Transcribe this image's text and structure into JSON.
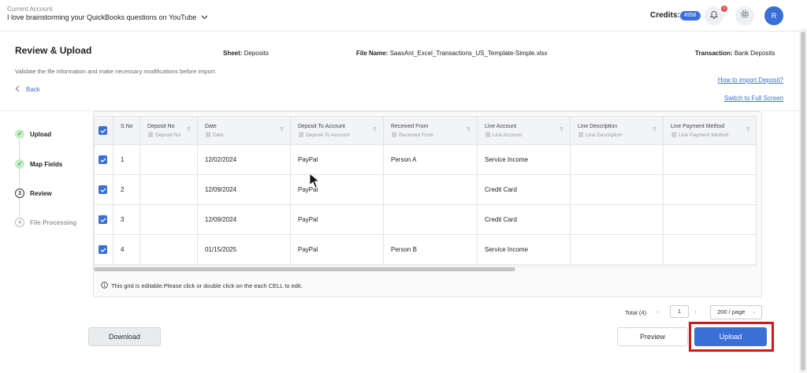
{
  "topbar": {
    "account_label": "Current Account",
    "account_name": "I love brainstorming your QuickBooks questions on YouTube",
    "credits_label": "Credits:",
    "credits_value": "4958",
    "notification_count": "0",
    "avatar_initial": "R"
  },
  "header": {
    "title": "Review & Upload",
    "sheet_label": "Sheet:",
    "sheet_value": "Deposits",
    "file_label": "File Name:",
    "file_value": "SaasAnt_Excel_Transactions_US_Template-Simple.xlsx",
    "transaction_label": "Transaction:",
    "transaction_value": "Bank Deposits",
    "subtitle": "Validate the file information and make necessary modifications before import.",
    "back_label": "Back",
    "how_to_link": "How to import Deposit?",
    "full_screen_link": "Switch to Full Screen"
  },
  "steps": [
    {
      "num": "1",
      "label": "Upload",
      "state": "done"
    },
    {
      "num": "2",
      "label": "Map Fields",
      "state": "done"
    },
    {
      "num": "3",
      "label": "Review",
      "state": "current"
    },
    {
      "num": "4",
      "label": "File Processing",
      "state": "todo"
    }
  ],
  "grid": {
    "columns": [
      {
        "title": "S.No",
        "sub": ""
      },
      {
        "title": "Deposit No",
        "sub": "Deposit No"
      },
      {
        "title": "Date",
        "sub": "Date"
      },
      {
        "title": "Deposit To Account",
        "sub": "Deposit To Account"
      },
      {
        "title": "Received From",
        "sub": "Received From"
      },
      {
        "title": "Line Account",
        "sub": "Line Account"
      },
      {
        "title": "Line Description",
        "sub": "Line Description"
      },
      {
        "title": "Line Payment Method",
        "sub": "Line Payment Method"
      }
    ],
    "rows": [
      [
        "1",
        "",
        "12/02/2024",
        "PayPal",
        "Person A",
        "Service Income",
        "",
        ""
      ],
      [
        "2",
        "",
        "12/09/2024",
        "PayPal",
        "",
        "Credit Card",
        "",
        ""
      ],
      [
        "3",
        "",
        "12/09/2024",
        "PayPal",
        "",
        "Credit Card",
        "",
        ""
      ],
      [
        "4",
        "",
        "01/15/2025",
        "PayPal",
        "Person B",
        "Service Income",
        "",
        ""
      ]
    ],
    "note": "This grid is editable.Please click or double click on the each CELL to edit."
  },
  "pagination": {
    "total": "Total (4)",
    "current_page": "1",
    "page_size": "200 / page"
  },
  "buttons": {
    "download": "Download",
    "preview": "Preview",
    "upload": "Upload"
  },
  "colors": {
    "accent": "#3b6fd8",
    "highlight_frame": "#d01818"
  }
}
